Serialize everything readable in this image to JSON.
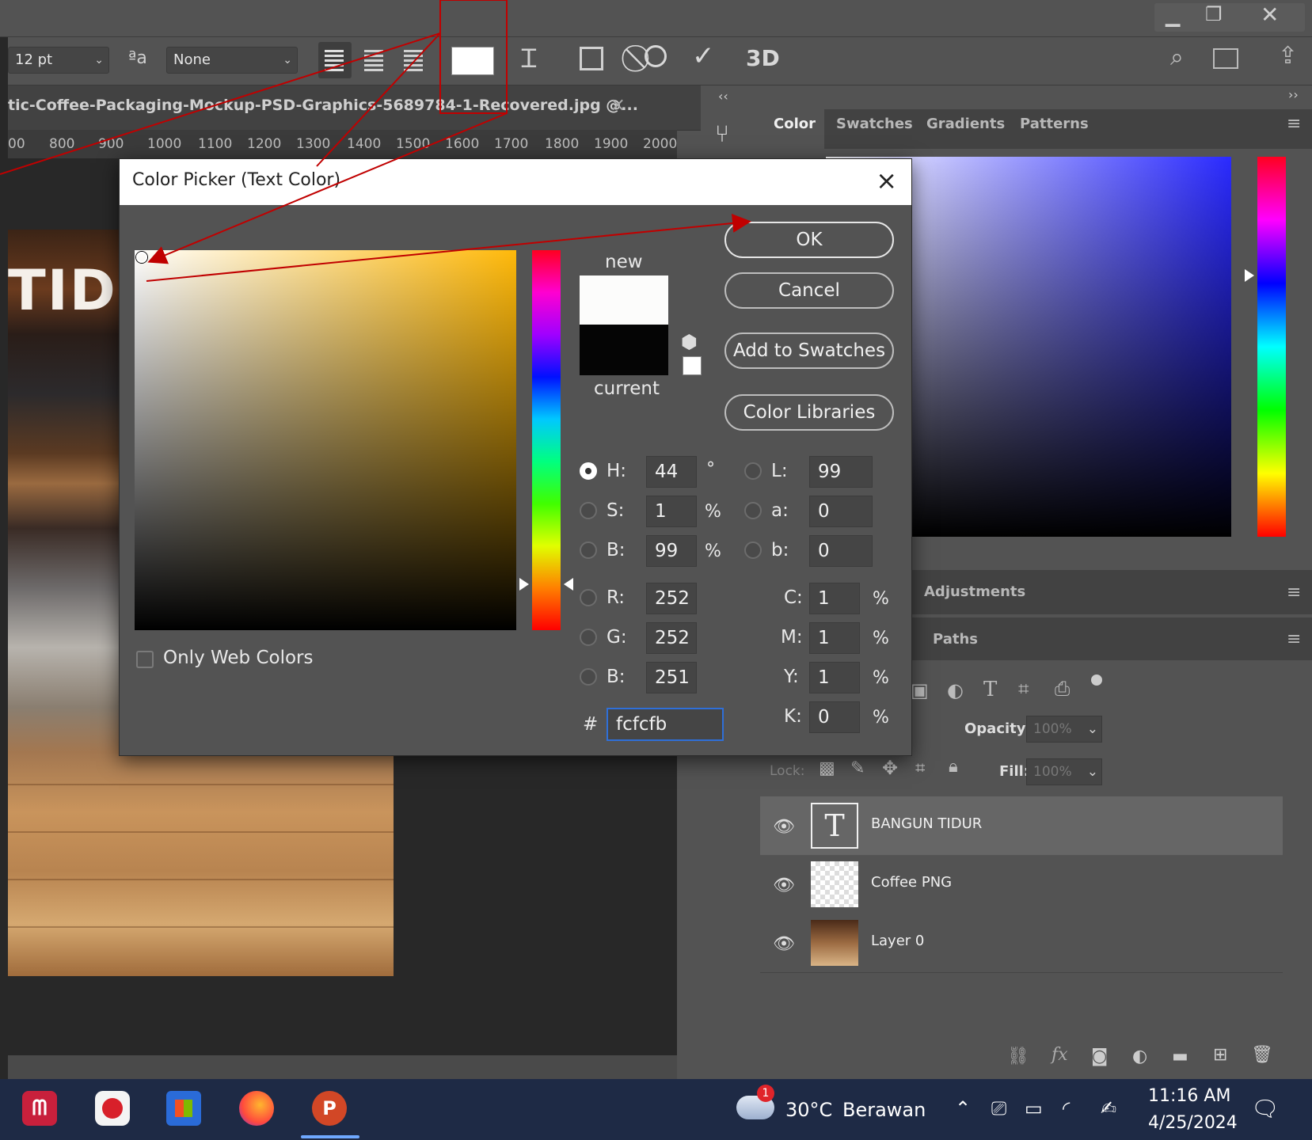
{
  "options_bar": {
    "font_size": "12 pt",
    "antialias_icon": "aa-icon",
    "antialias_value": "None",
    "three_d": "3D"
  },
  "document": {
    "tab_title": "tic-Coffee-Packaging-Mockup-PSD-Graphics-5689784-1-Recovered.jpg @...",
    "tab_close": "×",
    "ruler": [
      "00",
      "800",
      "900",
      "1000",
      "1100",
      "1200",
      "1300",
      "1400",
      "1500",
      "1600",
      "1700",
      "1800",
      "1900",
      "2000"
    ],
    "canvas_text": "TIDU"
  },
  "right_panel": {
    "tabs": [
      "Color",
      "Swatches",
      "Gradients",
      "Patterns"
    ],
    "adjustments_tab": "Adjustments",
    "paths_tab": "Paths",
    "opacity_label": "Opacity:",
    "opacity_value": "100%",
    "lock_label": "Lock:",
    "fill_label": "Fill:",
    "fill_value": "100%",
    "layers": [
      {
        "name": "BANGUN TIDUR",
        "type": "text"
      },
      {
        "name": "Coffee PNG",
        "type": "image"
      },
      {
        "name": "Layer 0",
        "type": "image"
      }
    ]
  },
  "dialog": {
    "title": "Color Picker (Text Color)",
    "close": "×",
    "new_label": "new",
    "current_label": "current",
    "new_color": "#fcfcfb",
    "current_color": "#050505",
    "buttons": {
      "ok": "OK",
      "cancel": "Cancel",
      "add_to_swatches": "Add to Swatches",
      "color_libraries": "Color Libraries"
    },
    "only_web_colors": "Only Web Colors",
    "fields": {
      "H": {
        "label": "H:",
        "value": "44",
        "unit": "°"
      },
      "S": {
        "label": "S:",
        "value": "1",
        "unit": "%"
      },
      "B": {
        "label": "B:",
        "value": "99",
        "unit": "%"
      },
      "R": {
        "label": "R:",
        "value": "252"
      },
      "G": {
        "label": "G:",
        "value": "252"
      },
      "Bl": {
        "label": "B:",
        "value": "251"
      },
      "L": {
        "label": "L:",
        "value": "99"
      },
      "a": {
        "label": "a:",
        "value": "0"
      },
      "b": {
        "label": "b:",
        "value": "0"
      },
      "C": {
        "label": "C:",
        "value": "1",
        "unit": "%"
      },
      "M": {
        "label": "M:",
        "value": "1",
        "unit": "%"
      },
      "Y": {
        "label": "Y:",
        "value": "1",
        "unit": "%"
      },
      "K": {
        "label": "K:",
        "value": "0",
        "unit": "%"
      }
    },
    "hex_label": "#",
    "hex_value": "fcfcfb"
  },
  "taskbar": {
    "weather_temp": "30°C",
    "weather_text": "Berawan",
    "weather_badge": "1",
    "time": "11:16 AM",
    "date": "4/25/2024",
    "powerpoint_letter": "P"
  },
  "colors": {
    "annotation_red": "#c00000",
    "panel_bg": "#535353",
    "taskbar_bg": "#1e2a45"
  }
}
